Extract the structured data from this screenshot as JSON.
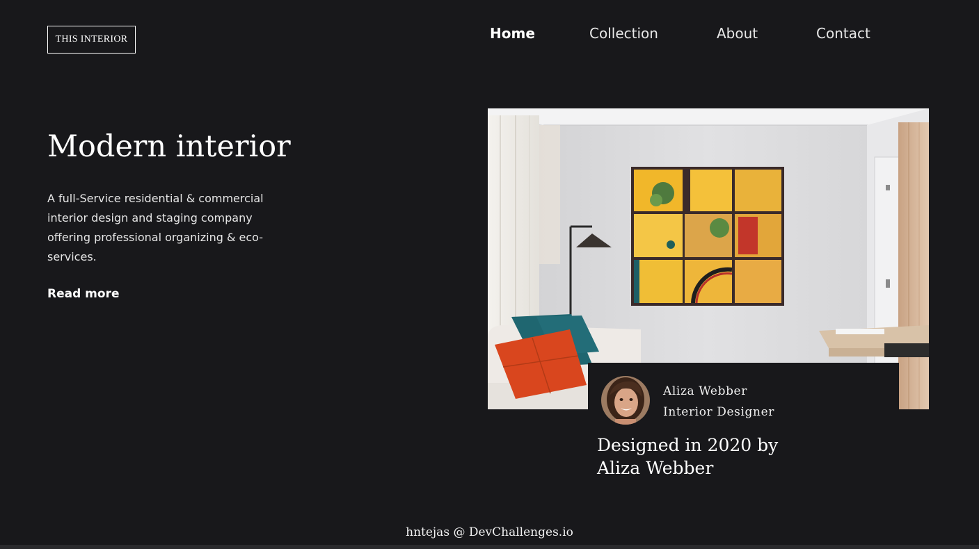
{
  "logo": {
    "text": "THIS INTERIOR"
  },
  "nav": {
    "items": [
      {
        "label": "Home",
        "active": true
      },
      {
        "label": "Collection",
        "active": false
      },
      {
        "label": "About",
        "active": false
      },
      {
        "label": "Contact",
        "active": false
      }
    ]
  },
  "hero": {
    "title": "Modern interior",
    "description": "A full-Service residential & commercial interior design and staging company offering professional organizing & eco-services.",
    "read_more": "Read more"
  },
  "designer": {
    "name": "Aliza Webber",
    "role": "Interior Designer",
    "credit": "Designed in 2020 by Aliza Webber"
  },
  "footer": {
    "text": "hntejas @ DevChallenges.io"
  },
  "colors": {
    "background": "#18181b",
    "text": "#ffffff",
    "wall": "#dcdcde",
    "frame_yellow": "#f2bc2e",
    "pillow_orange": "#d9461e",
    "pillow_teal": "#1f6670"
  }
}
